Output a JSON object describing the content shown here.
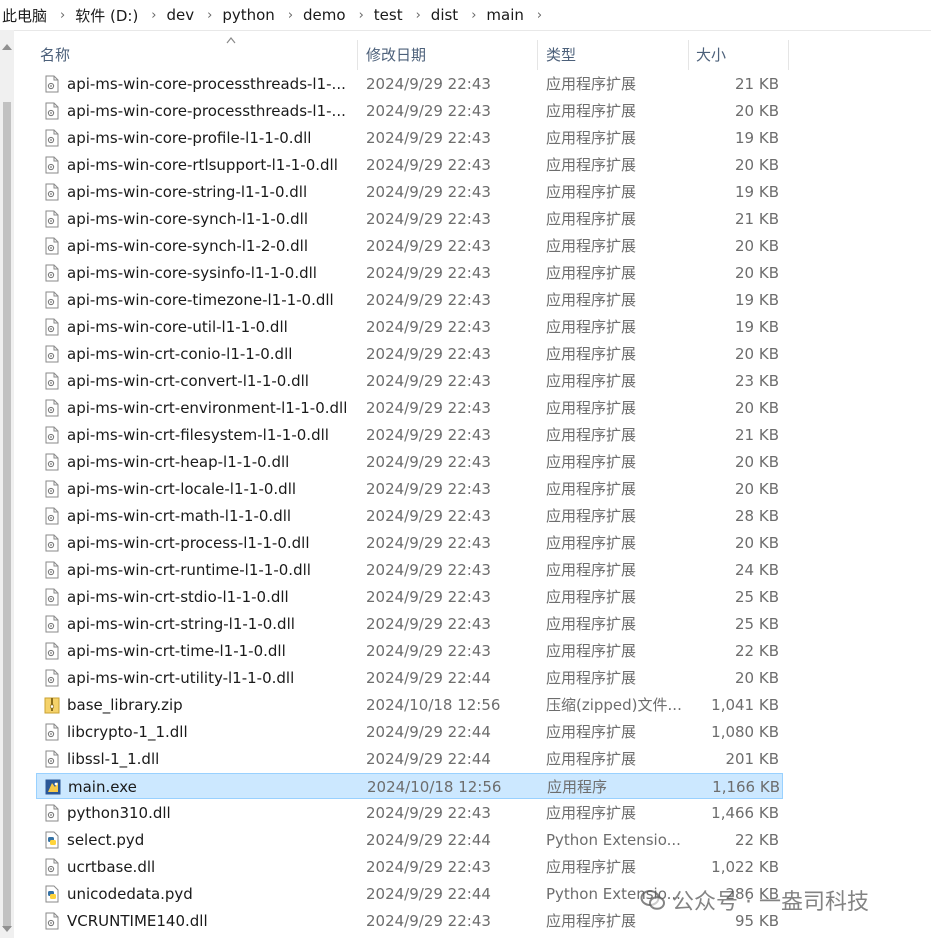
{
  "breadcrumb": [
    "此电脑",
    "软件 (D:)",
    "dev",
    "python",
    "demo",
    "test",
    "dist",
    "main"
  ],
  "columns": {
    "name": "名称",
    "date": "修改日期",
    "type": "类型",
    "size": "大小"
  },
  "files": [
    {
      "name": "api-ms-win-core-processthreads-l1-...",
      "date": "2024/9/29 22:43",
      "type": "应用程序扩展",
      "size": "21 KB",
      "icon": "dll-file-icon"
    },
    {
      "name": "api-ms-win-core-processthreads-l1-...",
      "date": "2024/9/29 22:43",
      "type": "应用程序扩展",
      "size": "20 KB",
      "icon": "dll-file-icon"
    },
    {
      "name": "api-ms-win-core-profile-l1-1-0.dll",
      "date": "2024/9/29 22:43",
      "type": "应用程序扩展",
      "size": "19 KB",
      "icon": "dll-file-icon"
    },
    {
      "name": "api-ms-win-core-rtlsupport-l1-1-0.dll",
      "date": "2024/9/29 22:43",
      "type": "应用程序扩展",
      "size": "20 KB",
      "icon": "dll-file-icon"
    },
    {
      "name": "api-ms-win-core-string-l1-1-0.dll",
      "date": "2024/9/29 22:43",
      "type": "应用程序扩展",
      "size": "19 KB",
      "icon": "dll-file-icon"
    },
    {
      "name": "api-ms-win-core-synch-l1-1-0.dll",
      "date": "2024/9/29 22:43",
      "type": "应用程序扩展",
      "size": "21 KB",
      "icon": "dll-file-icon"
    },
    {
      "name": "api-ms-win-core-synch-l1-2-0.dll",
      "date": "2024/9/29 22:43",
      "type": "应用程序扩展",
      "size": "20 KB",
      "icon": "dll-file-icon"
    },
    {
      "name": "api-ms-win-core-sysinfo-l1-1-0.dll",
      "date": "2024/9/29 22:43",
      "type": "应用程序扩展",
      "size": "20 KB",
      "icon": "dll-file-icon"
    },
    {
      "name": "api-ms-win-core-timezone-l1-1-0.dll",
      "date": "2024/9/29 22:43",
      "type": "应用程序扩展",
      "size": "19 KB",
      "icon": "dll-file-icon"
    },
    {
      "name": "api-ms-win-core-util-l1-1-0.dll",
      "date": "2024/9/29 22:43",
      "type": "应用程序扩展",
      "size": "19 KB",
      "icon": "dll-file-icon"
    },
    {
      "name": "api-ms-win-crt-conio-l1-1-0.dll",
      "date": "2024/9/29 22:43",
      "type": "应用程序扩展",
      "size": "20 KB",
      "icon": "dll-file-icon"
    },
    {
      "name": "api-ms-win-crt-convert-l1-1-0.dll",
      "date": "2024/9/29 22:43",
      "type": "应用程序扩展",
      "size": "23 KB",
      "icon": "dll-file-icon"
    },
    {
      "name": "api-ms-win-crt-environment-l1-1-0.dll",
      "date": "2024/9/29 22:43",
      "type": "应用程序扩展",
      "size": "20 KB",
      "icon": "dll-file-icon"
    },
    {
      "name": "api-ms-win-crt-filesystem-l1-1-0.dll",
      "date": "2024/9/29 22:43",
      "type": "应用程序扩展",
      "size": "21 KB",
      "icon": "dll-file-icon"
    },
    {
      "name": "api-ms-win-crt-heap-l1-1-0.dll",
      "date": "2024/9/29 22:43",
      "type": "应用程序扩展",
      "size": "20 KB",
      "icon": "dll-file-icon"
    },
    {
      "name": "api-ms-win-crt-locale-l1-1-0.dll",
      "date": "2024/9/29 22:43",
      "type": "应用程序扩展",
      "size": "20 KB",
      "icon": "dll-file-icon"
    },
    {
      "name": "api-ms-win-crt-math-l1-1-0.dll",
      "date": "2024/9/29 22:43",
      "type": "应用程序扩展",
      "size": "28 KB",
      "icon": "dll-file-icon"
    },
    {
      "name": "api-ms-win-crt-process-l1-1-0.dll",
      "date": "2024/9/29 22:43",
      "type": "应用程序扩展",
      "size": "20 KB",
      "icon": "dll-file-icon"
    },
    {
      "name": "api-ms-win-crt-runtime-l1-1-0.dll",
      "date": "2024/9/29 22:43",
      "type": "应用程序扩展",
      "size": "24 KB",
      "icon": "dll-file-icon"
    },
    {
      "name": "api-ms-win-crt-stdio-l1-1-0.dll",
      "date": "2024/9/29 22:43",
      "type": "应用程序扩展",
      "size": "25 KB",
      "icon": "dll-file-icon"
    },
    {
      "name": "api-ms-win-crt-string-l1-1-0.dll",
      "date": "2024/9/29 22:43",
      "type": "应用程序扩展",
      "size": "25 KB",
      "icon": "dll-file-icon"
    },
    {
      "name": "api-ms-win-crt-time-l1-1-0.dll",
      "date": "2024/9/29 22:43",
      "type": "应用程序扩展",
      "size": "22 KB",
      "icon": "dll-file-icon"
    },
    {
      "name": "api-ms-win-crt-utility-l1-1-0.dll",
      "date": "2024/9/29 22:44",
      "type": "应用程序扩展",
      "size": "20 KB",
      "icon": "dll-file-icon"
    },
    {
      "name": "base_library.zip",
      "date": "2024/10/18 12:56",
      "type": "压缩(zipped)文件...",
      "size": "1,041 KB",
      "icon": "zip-folder-icon"
    },
    {
      "name": "libcrypto-1_1.dll",
      "date": "2024/9/29 22:44",
      "type": "应用程序扩展",
      "size": "1,080 KB",
      "icon": "dll-file-icon"
    },
    {
      "name": "libssl-1_1.dll",
      "date": "2024/9/29 22:44",
      "type": "应用程序扩展",
      "size": "201 KB",
      "icon": "dll-file-icon"
    },
    {
      "name": "main.exe",
      "date": "2024/10/18 12:56",
      "type": "应用程序",
      "size": "1,166 KB",
      "icon": "exe-app-icon",
      "selected": true
    },
    {
      "name": "python310.dll",
      "date": "2024/9/29 22:43",
      "type": "应用程序扩展",
      "size": "1,466 KB",
      "icon": "dll-file-icon"
    },
    {
      "name": "select.pyd",
      "date": "2024/9/29 22:44",
      "type": "Python Extensio...",
      "size": "22 KB",
      "icon": "python-file-icon"
    },
    {
      "name": "ucrtbase.dll",
      "date": "2024/9/29 22:43",
      "type": "应用程序扩展",
      "size": "1,022 KB",
      "icon": "dll-file-icon"
    },
    {
      "name": "unicodedata.pyd",
      "date": "2024/9/29 22:44",
      "type": "Python Extensio...",
      "size": "286 KB",
      "icon": "python-file-icon"
    },
    {
      "name": "VCRUNTIME140.dll",
      "date": "2024/9/29 22:43",
      "type": "应用程序扩展",
      "size": "95 KB",
      "icon": "dll-file-icon"
    }
  ],
  "watermark": "公众号 · 一盎司科技",
  "colors": {
    "selection_bg": "#cce8ff",
    "selection_border": "#99d1ff",
    "header_text": "#4c607a",
    "meta_text": "#6d6d6d"
  }
}
